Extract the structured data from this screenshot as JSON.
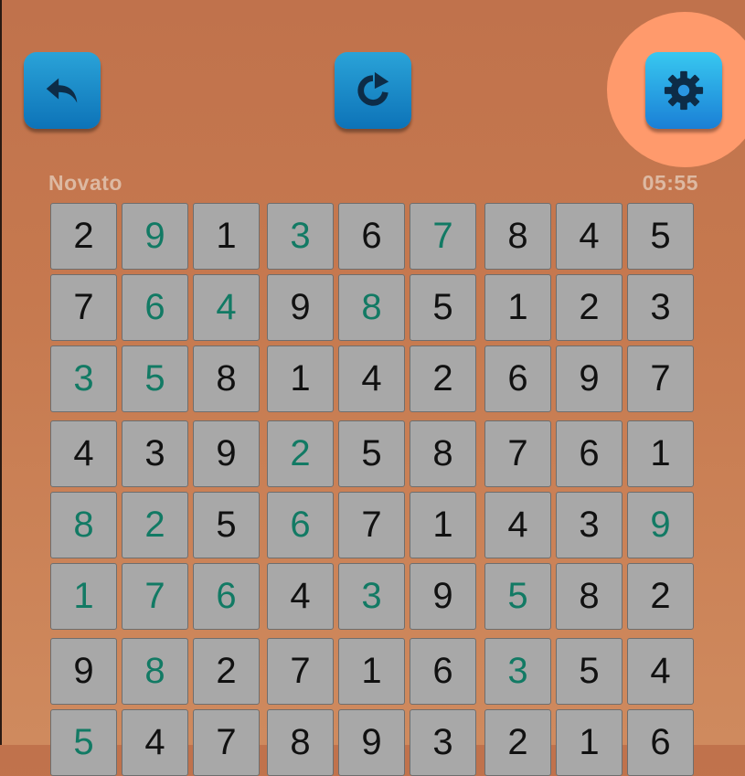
{
  "toolbar": {
    "undo_icon": "undo-arrow-icon",
    "restart_icon": "restart-icon",
    "settings_icon": "gear-icon"
  },
  "status": {
    "difficulty": "Novato",
    "timer": "05:55"
  },
  "colors": {
    "given": "#127a64",
    "entered": "#111111",
    "highlight": "#ff9a6c"
  },
  "board": {
    "rows": [
      [
        2,
        9,
        1,
        3,
        6,
        7,
        8,
        4,
        5
      ],
      [
        7,
        6,
        4,
        9,
        8,
        5,
        1,
        2,
        3
      ],
      [
        3,
        5,
        8,
        1,
        4,
        2,
        6,
        9,
        7
      ],
      [
        4,
        3,
        9,
        2,
        5,
        8,
        7,
        6,
        1
      ],
      [
        8,
        2,
        5,
        6,
        7,
        1,
        4,
        3,
        9
      ],
      [
        1,
        7,
        6,
        4,
        3,
        9,
        5,
        8,
        2
      ],
      [
        9,
        8,
        2,
        7,
        1,
        6,
        3,
        5,
        4
      ],
      [
        5,
        4,
        7,
        8,
        9,
        3,
        2,
        1,
        6
      ]
    ],
    "given": [
      [
        0,
        1,
        0,
        1,
        0,
        1,
        0,
        0,
        0
      ],
      [
        0,
        1,
        1,
        0,
        1,
        0,
        0,
        0,
        0
      ],
      [
        1,
        1,
        0,
        0,
        0,
        0,
        0,
        0,
        0
      ],
      [
        0,
        0,
        0,
        1,
        0,
        0,
        0,
        0,
        0
      ],
      [
        1,
        1,
        0,
        1,
        0,
        0,
        0,
        0,
        1
      ],
      [
        1,
        1,
        1,
        0,
        1,
        0,
        1,
        0,
        0
      ],
      [
        0,
        1,
        0,
        0,
        0,
        0,
        1,
        0,
        0
      ],
      [
        1,
        0,
        0,
        0,
        0,
        0,
        0,
        0,
        0
      ]
    ]
  }
}
